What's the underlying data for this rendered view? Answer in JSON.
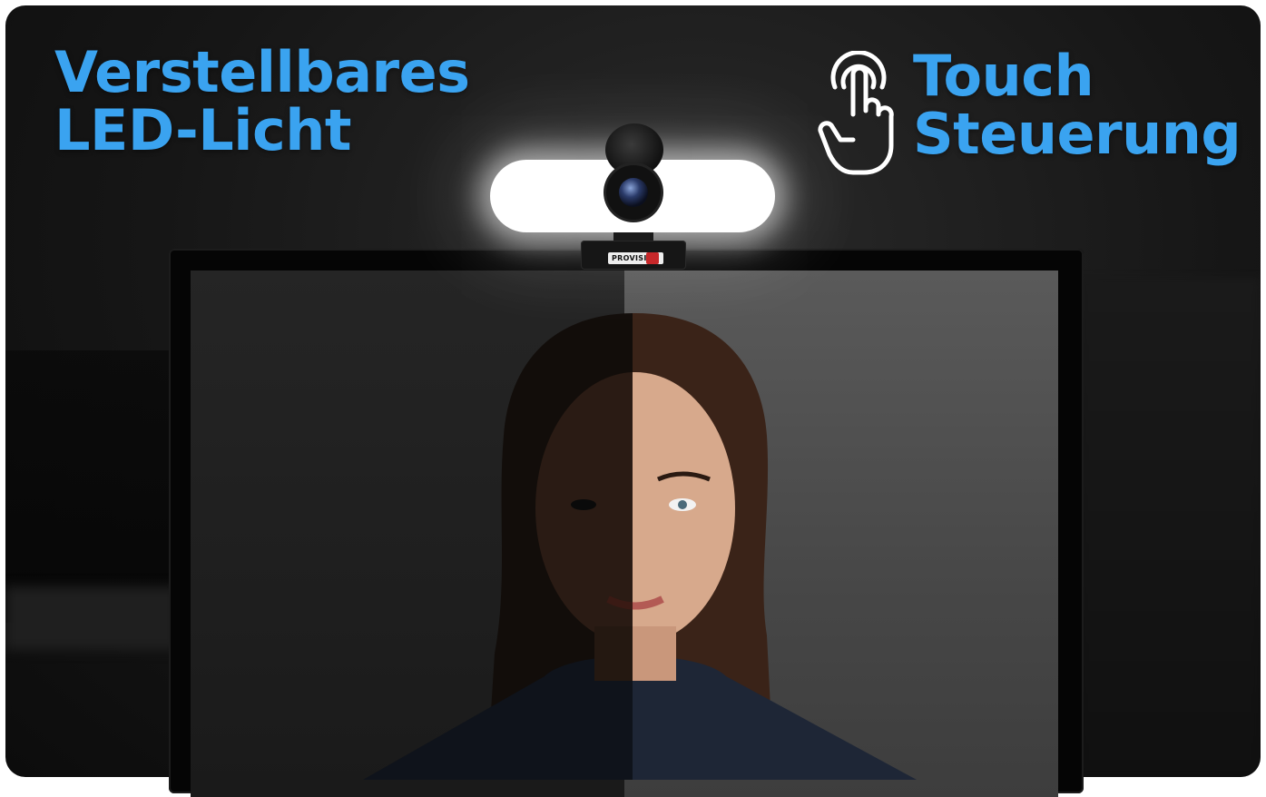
{
  "headline_left": {
    "line1": "Verstellbares",
    "line2": "LED-Licht"
  },
  "headline_right": {
    "line1": "Touch",
    "line2": "Steuerung"
  },
  "webcam": {
    "brand": "PROVISION"
  },
  "colors": {
    "headline": "#3aa3f0",
    "background": "#141414",
    "light": "#ffffff"
  },
  "icons": {
    "touch": "touch-gesture-icon"
  }
}
